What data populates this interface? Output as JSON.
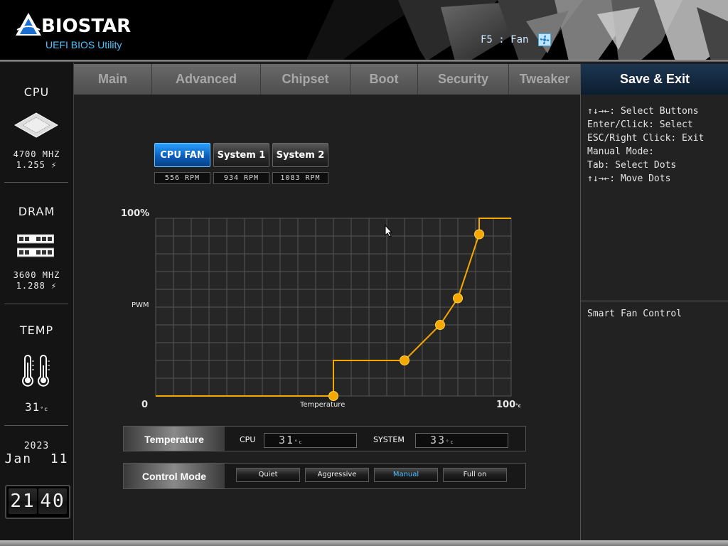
{
  "header": {
    "brand": "BIOSTAR",
    "subtitle": "UEFI BIOS Utility",
    "hotkey": "F5 : Fan",
    "hotkey_icon": "fan-icon"
  },
  "left_panel": {
    "cpu": {
      "title": "CPU",
      "freq": "4700 MHZ",
      "volt": "1.255",
      "icon": "cpu-chip-icon"
    },
    "dram": {
      "title": "DRAM",
      "freq": "3600 MHZ",
      "volt": "1.288",
      "icon": "memory-module-icon"
    },
    "temp": {
      "title": "TEMP",
      "value": "31",
      "unit": "°c",
      "icon": "thermometer-icon"
    },
    "date": {
      "year": "2023",
      "month": "Jan",
      "day": "11"
    },
    "clock": {
      "hours": "21",
      "minutes": "40"
    }
  },
  "tabs": [
    "Main",
    "Advanced",
    "Chipset",
    "Boot",
    "Security",
    "Tweaker",
    "Save & Exit"
  ],
  "active_tab": "Save & Exit",
  "fans": [
    {
      "label": "CPU FAN",
      "rpm": "556 RPM",
      "selected": true
    },
    {
      "label": "System 1",
      "rpm": "934 RPM",
      "selected": false
    },
    {
      "label": "System 2",
      "rpm": "1083 RPM",
      "selected": false
    }
  ],
  "chart_labels": {
    "y_top": "100%",
    "y_mid": "PWM",
    "x_start": "0",
    "x_mid": "Temperature",
    "x_end": "100",
    "x_end_unit": "°c"
  },
  "chart_data": {
    "type": "line",
    "title": "",
    "xlabel": "Temperature",
    "ylabel": "PWM",
    "xlim": [
      0,
      100
    ],
    "ylim": [
      0,
      100
    ],
    "grid": true,
    "series": [
      {
        "x": [
          0,
          50,
          50,
          70,
          80,
          85,
          91,
          91,
          100
        ],
        "y": [
          0,
          0,
          20,
          20,
          40,
          55,
          91,
          100,
          100
        ]
      }
    ],
    "control_points": {
      "x": [
        50,
        70,
        80,
        85,
        91
      ],
      "y": [
        0,
        20,
        40,
        55,
        91
      ]
    },
    "line_color": "#f5a800",
    "grid_color": "#555555"
  },
  "temperature_bar": {
    "label": "Temperature",
    "items": [
      {
        "name": "CPU",
        "value": "31",
        "unit": "°c"
      },
      {
        "name": "SYSTEM",
        "value": "33",
        "unit": "°c"
      }
    ]
  },
  "control_mode": {
    "label": "Control Mode",
    "options": [
      "Quiet",
      "Aggressive",
      "Manual",
      "Full on"
    ],
    "selected": "Manual"
  },
  "help": {
    "lines": [
      "↑↓→←: Select Buttons",
      "Enter/Click: Select",
      "ESC/Right Click: Exit",
      "Manual Mode:",
      "Tab: Select Dots",
      "↑↓→←: Move Dots"
    ],
    "description": "Smart Fan Control"
  },
  "colors": {
    "accent": "#4fc3ff",
    "curve": "#f5a800",
    "selected_tab": "#0c1e30"
  }
}
